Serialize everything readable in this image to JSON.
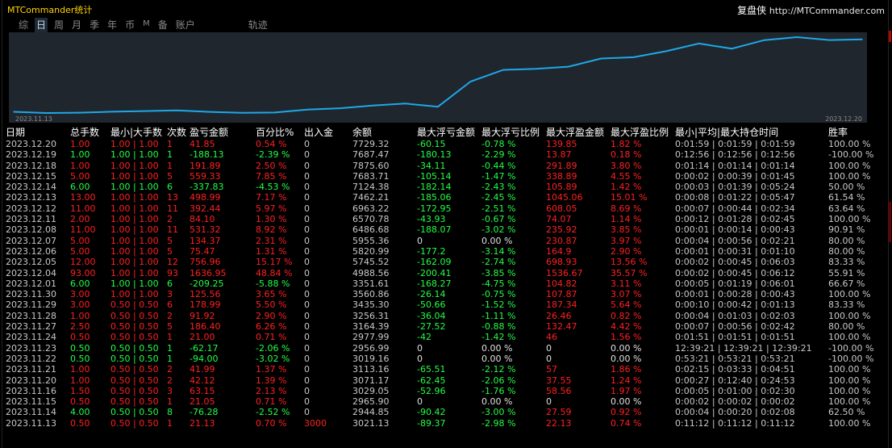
{
  "header": {
    "title": "MTCommander统计",
    "brand_name": "复盘侠",
    "brand_url": "http://MTCommander.com"
  },
  "tabs": [
    "综",
    "日",
    "周",
    "月",
    "季",
    "年",
    "币",
    "M",
    "备",
    "账户",
    "轨迹"
  ],
  "active_tab": "日",
  "chart_data": {
    "type": "line",
    "start_label": "2023.11.13",
    "end_label": "2023.12.20",
    "line_color": "#1fa8e8",
    "background": "#1f262d",
    "x": [
      "2023.11.13",
      "2023.11.14",
      "2023.11.15",
      "2023.11.16",
      "2023.11.20",
      "2023.11.21",
      "2023.11.22",
      "2023.11.23",
      "2023.11.24",
      "2023.11.27",
      "2023.11.28",
      "2023.11.29",
      "2023.11.30",
      "2023.12.01",
      "2023.12.04",
      "2023.12.05",
      "2023.12.06",
      "2023.12.07",
      "2023.12.08",
      "2023.12.11",
      "2023.12.12",
      "2023.12.13",
      "2023.12.14",
      "2023.12.15",
      "2023.12.18",
      "2023.12.19",
      "2023.12.20"
    ],
    "values": [
      3021.13,
      2944.85,
      2965.9,
      3029.05,
      3071.17,
      3113.16,
      3019.16,
      2956.99,
      2977.99,
      3164.39,
      3256.31,
      3435.3,
      3560.86,
      3351.61,
      4988.56,
      5745.52,
      5820.99,
      5955.36,
      6486.68,
      6570.78,
      6963.22,
      7462.21,
      7124.38,
      7683.71,
      7875.6,
      7687.47,
      7729.32
    ]
  },
  "table": {
    "headers": [
      "日期",
      "总手数",
      "最小|大手数",
      "次数",
      "盈亏金额",
      "百分比%",
      "出入金",
      "余额",
      "最大浮亏金额",
      "最大浮亏比例",
      "最大浮盈金额",
      "最大浮盈比例",
      "最小|平均|最大持仓时间",
      "胜率"
    ],
    "rows": [
      {
        "color": "red",
        "cells": [
          "2023.12.20",
          "1.00",
          "1.00 | 1.00",
          "1",
          "41.85",
          "0.54 %",
          "0",
          "7729.32",
          "-60.15",
          "-0.78 %",
          "139.85",
          "1.82 %",
          "0:01:59 | 0:01:59 | 0:01:59",
          "100.00 %"
        ]
      },
      {
        "color": "green",
        "cells": [
          "2023.12.19",
          "1.00",
          "1.00 | 1.00",
          "1",
          "-188.13",
          "-2.39 %",
          "0",
          "7687.47",
          "-180.13",
          "-2.29 %",
          "13.87",
          "0.18 %",
          "0:12:56 | 0:12:56 | 0:12:56",
          "-100.00 %"
        ]
      },
      {
        "color": "red",
        "cells": [
          "2023.12.18",
          "1.00",
          "1.00 | 1.00",
          "1",
          "191.89",
          "2.50 %",
          "0",
          "7875.60",
          "-34.11",
          "-0.44 %",
          "291.89",
          "3.80 %",
          "0:01:14 | 0:01:14 | 0:01:14",
          "100.00 %"
        ]
      },
      {
        "color": "red",
        "cells": [
          "2023.12.15",
          "5.00",
          "1.00 | 1.00",
          "5",
          "559.33",
          "7.85 %",
          "0",
          "7683.71",
          "-105.14",
          "-1.47 %",
          "338.89",
          "4.55 %",
          "0:00:02 | 0:00:39 | 0:01:45",
          "100.00 %"
        ]
      },
      {
        "color": "green",
        "cells": [
          "2023.12.14",
          "6.00",
          "1.00 | 1.00",
          "6",
          "-337.83",
          "-4.53 %",
          "0",
          "7124.38",
          "-182.14",
          "-2.43 %",
          "105.89",
          "1.42 %",
          "0:00:03 | 0:01:39 | 0:05:24",
          "50.00 %"
        ]
      },
      {
        "color": "red",
        "cells": [
          "2023.12.13",
          "13.00",
          "1.00 | 1.00",
          "13",
          "498.99",
          "7.17 %",
          "0",
          "7462.21",
          "-185.06",
          "-2.45 %",
          "1045.06",
          "15.01 %",
          "0:00:08 | 0:01:22 | 0:05:47",
          "61.54 %"
        ]
      },
      {
        "color": "red",
        "cells": [
          "2023.12.12",
          "11.00",
          "1.00 | 1.00",
          "11",
          "392.44",
          "5.97 %",
          "0",
          "6963.22",
          "-172.95",
          "-2.51 %",
          "608.05",
          "8.69 %",
          "0:00:07 | 0:00:44 | 0:02:34",
          "63.64 %"
        ]
      },
      {
        "color": "red",
        "cells": [
          "2023.12.11",
          "2.00",
          "1.00 | 1.00",
          "2",
          "84.10",
          "1.30 %",
          "0",
          "6570.78",
          "-43.93",
          "-0.67 %",
          "74.07",
          "1.14 %",
          "0:00:12 | 0:01:28 | 0:02:45",
          "100.00 %"
        ]
      },
      {
        "color": "red",
        "cells": [
          "2023.12.08",
          "11.00",
          "1.00 | 1.00",
          "11",
          "531.32",
          "8.92 %",
          "0",
          "6486.68",
          "-188.07",
          "-3.02 %",
          "235.92",
          "3.85 %",
          "0:00:01 | 0:00:14 | 0:00:43",
          "90.91 %"
        ]
      },
      {
        "color": "red",
        "cells": [
          "2023.12.07",
          "5.00",
          "1.00 | 1.00",
          "5",
          "134.37",
          "2.31 %",
          "0",
          "5955.36",
          "0",
          "0.00 %",
          "230.87",
          "3.97 %",
          "0:00:04 | 0:00:56 | 0:02:21",
          "80.00 %"
        ]
      },
      {
        "color": "red",
        "cells": [
          "2023.12.06",
          "5.00",
          "1.00 | 1.00",
          "5",
          "75.47",
          "1.31 %",
          "0",
          "5820.99",
          "-177.2",
          "-3.14 %",
          "164.9",
          "2.90 %",
          "0:00:01 | 0:00:31 | 0:01:10",
          "80.00 %"
        ]
      },
      {
        "color": "red",
        "cells": [
          "2023.12.05",
          "12.00",
          "1.00 | 1.00",
          "12",
          "756.96",
          "15.17 %",
          "0",
          "5745.52",
          "-162.09",
          "-2.74 %",
          "698.93",
          "13.56 %",
          "0:00:02 | 0:00:45 | 0:06:03",
          "83.33 %"
        ]
      },
      {
        "color": "red",
        "cells": [
          "2023.12.04",
          "93.00",
          "1.00 | 1.00",
          "93",
          "1636.95",
          "48.84 %",
          "0",
          "4988.56",
          "-200.41",
          "-3.85 %",
          "1536.67",
          "35.57 %",
          "0:00:02 | 0:00:45 | 0:06:12",
          "55.91 %"
        ]
      },
      {
        "color": "green",
        "cells": [
          "2023.12.01",
          "6.00",
          "1.00 | 1.00",
          "6",
          "-209.25",
          "-5.88 %",
          "0",
          "3351.61",
          "-168.27",
          "-4.75 %",
          "104.82",
          "3.11 %",
          "0:00:05 | 0:01:19 | 0:06:01",
          "66.67 %"
        ]
      },
      {
        "color": "red",
        "cells": [
          "2023.11.30",
          "3.00",
          "1.00 | 1.00",
          "3",
          "125.56",
          "3.65 %",
          "0",
          "3560.86",
          "-26.14",
          "-0.75 %",
          "107.87",
          "3.07 %",
          "0:00:01 | 0:00:28 | 0:00:43",
          "100.00 %"
        ]
      },
      {
        "color": "red",
        "cells": [
          "2023.11.29",
          "3.00",
          "0.50 | 0.50",
          "6",
          "178.99",
          "5.50 %",
          "0",
          "3435.30",
          "-50.66",
          "-1.52 %",
          "187.34",
          "5.64 %",
          "0:00:10 | 0:00:42 | 0:01:13",
          "83.33 %"
        ]
      },
      {
        "color": "red",
        "cells": [
          "2023.11.28",
          "1.00",
          "0.50 | 0.50",
          "2",
          "91.92",
          "2.90 %",
          "0",
          "3256.31",
          "-36.04",
          "-1.11 %",
          "26.46",
          "0.82 %",
          "0:00:04 | 0:01:03 | 0:02:03",
          "100.00 %"
        ]
      },
      {
        "color": "red",
        "cells": [
          "2023.11.27",
          "2.50",
          "0.50 | 0.50",
          "5",
          "186.40",
          "6.26 %",
          "0",
          "3164.39",
          "-27.52",
          "-0.88 %",
          "132.47",
          "4.42 %",
          "0:00:07 | 0:00:56 | 0:02:42",
          "80.00 %"
        ]
      },
      {
        "color": "red",
        "cells": [
          "2023.11.24",
          "0.50",
          "0.50 | 0.50",
          "1",
          "21.00",
          "0.71 %",
          "0",
          "2977.99",
          "-42",
          "-1.42 %",
          "46",
          "1.56 %",
          "0:01:51 | 0:01:51 | 0:01:51",
          "100.00 %"
        ]
      },
      {
        "color": "green",
        "cells": [
          "2023.11.23",
          "0.50",
          "0.50 | 0.50",
          "1",
          "-62.17",
          "-2.06 %",
          "0",
          "2956.99",
          "0",
          "0.00 %",
          "0",
          "0.00 %",
          "12:39:21 | 12:39:21 | 12:39:21",
          "-100.00 %"
        ]
      },
      {
        "color": "green",
        "cells": [
          "2023.11.22",
          "0.50",
          "0.50 | 0.50",
          "1",
          "-94.00",
          "-3.02 %",
          "0",
          "3019.16",
          "0",
          "0.00 %",
          "0",
          "0.00 %",
          "0:53:21 | 0:53:21 | 0:53:21",
          "-100.00 %"
        ]
      },
      {
        "color": "red",
        "cells": [
          "2023.11.21",
          "1.00",
          "0.50 | 0.50",
          "2",
          "41.99",
          "1.37 %",
          "0",
          "3113.16",
          "-65.51",
          "-2.12 %",
          "57",
          "1.86 %",
          "0:02:15 | 0:03:33 | 0:04:51",
          "100.00 %"
        ]
      },
      {
        "color": "red",
        "cells": [
          "2023.11.20",
          "1.00",
          "0.50 | 0.50",
          "2",
          "42.12",
          "1.39 %",
          "0",
          "3071.17",
          "-62.45",
          "-2.06 %",
          "37.55",
          "1.24 %",
          "0:00:27 | 0:12:40 | 0:24:53",
          "100.00 %"
        ]
      },
      {
        "color": "red",
        "cells": [
          "2023.11.16",
          "1.50",
          "0.50 | 0.50",
          "3",
          "63.15",
          "2.13 %",
          "0",
          "3029.05",
          "-52.96",
          "-1.76 %",
          "58.56",
          "1.97 %",
          "0:00:05 | 0:01:00 | 0:02:30",
          "100.00 %"
        ]
      },
      {
        "color": "red",
        "cells": [
          "2023.11.15",
          "0.50",
          "0.50 | 0.50",
          "1",
          "21.05",
          "0.71 %",
          "0",
          "2965.90",
          "0",
          "0.00 %",
          "0",
          "0.00 %",
          "0:00:02 | 0:00:02 | 0:00:02",
          "100.00 %"
        ]
      },
      {
        "color": "green",
        "cells": [
          "2023.11.14",
          "4.00",
          "0.50 | 0.50",
          "8",
          "-76.28",
          "-2.52 %",
          "0",
          "2944.85",
          "-90.42",
          "-3.00 %",
          "27.59",
          "0.92 %",
          "0:00:04 | 0:00:20 | 0:02:08",
          "62.50 %"
        ]
      },
      {
        "color": "red",
        "cells": [
          "2023.11.13",
          "0.50",
          "0.50 | 0.50",
          "1",
          "21.13",
          "0.70 %",
          "3000",
          "3021.13",
          "-89.37",
          "-2.98 %",
          "22.13",
          "0.74 %",
          "0:11:12 | 0:11:12 | 0:11:12",
          "100.00 %"
        ]
      }
    ]
  }
}
